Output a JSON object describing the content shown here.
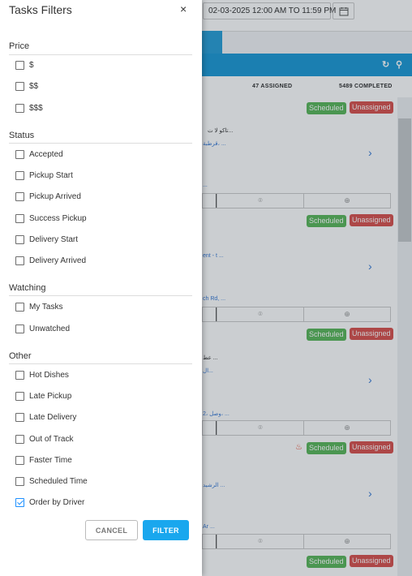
{
  "background": {
    "date_range": "02-03-2025 12:00 AM TO 11:59 PM",
    "assigned_count": "47 ASSIGNED",
    "completed_count": "5489 COMPLETED",
    "cards": [
      {
        "status": "Scheduled",
        "assignment": "Unassigned",
        "line1": "تاكو لا ت...",
        "line2": "قرطبة، ...",
        "line3": "..."
      },
      {
        "status": "Scheduled",
        "assignment": "Unassigned",
        "line1": "ent - t ...",
        "line2": "ch Rd, ..."
      },
      {
        "status": "Scheduled",
        "assignment": "Unassigned",
        "line1": "عط ...",
        "line2": "ال...",
        "line3": "2، وصل، ..."
      },
      {
        "status": "Scheduled",
        "assignment": "Unassigned",
        "line1": "الرشيد ...",
        "line2": "Ar ..."
      },
      {
        "status": "Scheduled",
        "assignment": "Unassigned"
      }
    ]
  },
  "panel": {
    "title": "Tasks Filters",
    "close_icon": "×",
    "sections": [
      {
        "title": "Price",
        "options": [
          {
            "label": "$",
            "checked": false
          },
          {
            "label": "$$",
            "checked": false
          },
          {
            "label": "$$$",
            "checked": false
          }
        ]
      },
      {
        "title": "Status",
        "options": [
          {
            "label": "Accepted",
            "checked": false
          },
          {
            "label": "Pickup Start",
            "checked": false
          },
          {
            "label": "Pickup Arrived",
            "checked": false
          },
          {
            "label": "Success Pickup",
            "checked": false
          },
          {
            "label": "Delivery Start",
            "checked": false
          },
          {
            "label": "Delivery Arrived",
            "checked": false
          }
        ]
      },
      {
        "title": "Watching",
        "options": [
          {
            "label": "My Tasks",
            "checked": false
          },
          {
            "label": "Unwatched",
            "checked": false
          }
        ]
      },
      {
        "title": "Other",
        "options": [
          {
            "label": "Hot Dishes",
            "checked": false
          },
          {
            "label": "Late Pickup",
            "checked": false
          },
          {
            "label": "Late Delivery",
            "checked": false
          },
          {
            "label": "Out of Track",
            "checked": false
          },
          {
            "label": "Faster Time",
            "checked": false
          },
          {
            "label": "Scheduled Time",
            "checked": false
          },
          {
            "label": "Order by Driver",
            "checked": true
          }
        ]
      }
    ],
    "cancel_label": "CANCEL",
    "filter_label": "FILTER"
  },
  "colors": {
    "primary": "#19a7ee",
    "scheduled": "#5cb85c",
    "unassigned": "#d9534f",
    "header_blue": "#1e9ad6"
  }
}
